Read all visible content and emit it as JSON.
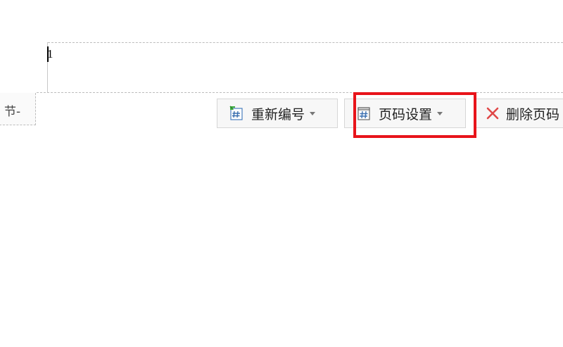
{
  "document": {
    "page_number": "1"
  },
  "section_tag": {
    "label": "节-"
  },
  "toolbar": {
    "renumber": {
      "label": "重新编号",
      "icon": "renumber-page-icon"
    },
    "page_number_settings": {
      "label": "页码设置",
      "icon": "page-number-icon"
    },
    "delete_page_number": {
      "label": "删除页码",
      "icon": "delete-x-icon"
    }
  },
  "annotation": {
    "highlight_color": "#e8141a",
    "highlighted": "page_number_settings"
  }
}
